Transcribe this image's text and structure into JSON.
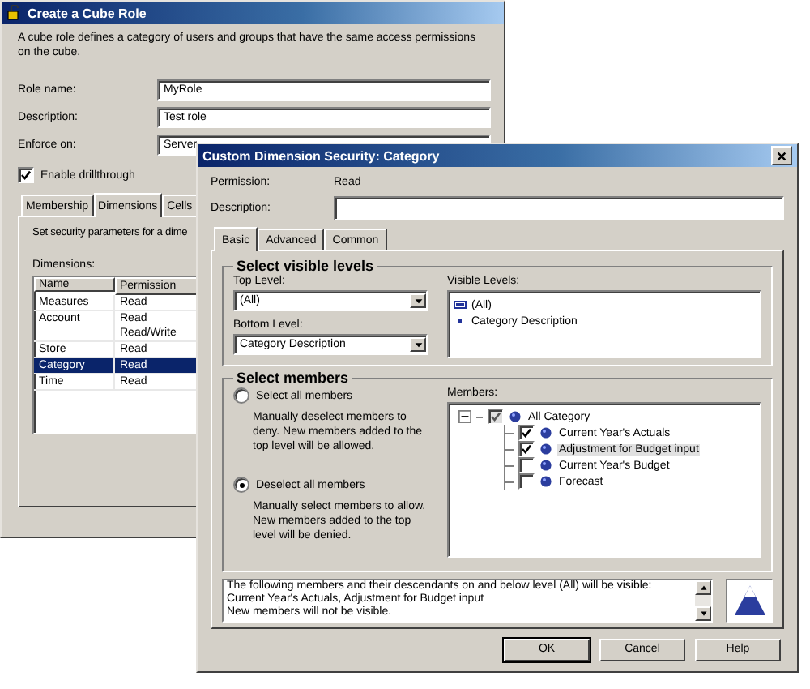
{
  "back_window": {
    "title": "Create a Cube Role",
    "intro": "A cube role defines a category of users and groups that have the same access permissions on the cube.",
    "fields": [
      {
        "label": "Role name:",
        "value": "MyRole"
      },
      {
        "label": "Description:",
        "value": "Test role"
      },
      {
        "label": "Enforce on:",
        "value": "Server"
      }
    ],
    "drillthrough": {
      "label": "Enable drillthrough",
      "checked": true
    },
    "tabs": [
      {
        "label": "Membership",
        "selected": false
      },
      {
        "label": "Dimensions",
        "selected": true
      },
      {
        "label": "Cells",
        "selected": false
      }
    ],
    "hint": "Set security parameters for a dime",
    "dimensions_label": "Dimensions:",
    "table": {
      "columns": [
        "Name",
        "Permission"
      ],
      "rows": [
        {
          "name": "Measures",
          "permissions": [
            "Read"
          ],
          "selected": false
        },
        {
          "name": "Account",
          "permissions": [
            "Read",
            "Read/Write"
          ],
          "selected": false
        },
        {
          "name": "Store",
          "permissions": [
            "Read"
          ],
          "selected": false
        },
        {
          "name": "Category",
          "permissions": [
            "Read"
          ],
          "selected": true
        },
        {
          "name": "Time",
          "permissions": [
            "Read"
          ],
          "selected": false
        }
      ]
    }
  },
  "front_window": {
    "title": "Custom Dimension Security: Category",
    "permission": {
      "label": "Permission:",
      "value": "Read"
    },
    "description": {
      "label": "Description:"
    },
    "tabs": [
      {
        "label": "Basic",
        "selected": true
      },
      {
        "label": "Advanced",
        "selected": false
      },
      {
        "label": "Common",
        "selected": false
      }
    ],
    "levels_group": {
      "title": "Select visible levels",
      "top_level": {
        "label": "Top Level:",
        "value": "(All)"
      },
      "bottom_level": {
        "label": "Bottom Level:",
        "value": "Category Description"
      },
      "visible_levels": {
        "label": "Visible Levels:",
        "items": [
          {
            "text": "(All)",
            "kind": "level"
          },
          {
            "text": "Category Description",
            "kind": "bullet"
          }
        ]
      }
    },
    "members_group": {
      "title": "Select members",
      "options": [
        {
          "label": "Select all members",
          "selected": false,
          "note": "Manually deselect members to deny. New members added to the top level will be allowed."
        },
        {
          "label": "Deselect all members",
          "selected": true,
          "note": "Manually select members to allow. New members added to the top level will be denied."
        }
      ],
      "members": {
        "label": "Members:",
        "tree": [
          {
            "text": "All Category",
            "checked": true,
            "expanded": true,
            "selected": false,
            "children": [
              {
                "text": "Current Year's Actuals",
                "checked": true,
                "selected": false
              },
              {
                "text": "Adjustment for Budget input",
                "checked": true,
                "selected": true
              },
              {
                "text": "Current Year's Budget",
                "checked": false,
                "selected": false
              },
              {
                "text": "Forecast",
                "checked": false,
                "selected": false
              }
            ]
          }
        ]
      }
    },
    "summary": [
      "The following members and their descendants on and below level (All) will be visible: Current Year's Actuals, Adjustment for Budget input",
      "New members will not be visible."
    ],
    "buttons": [
      "OK",
      "Cancel",
      "Help"
    ]
  }
}
